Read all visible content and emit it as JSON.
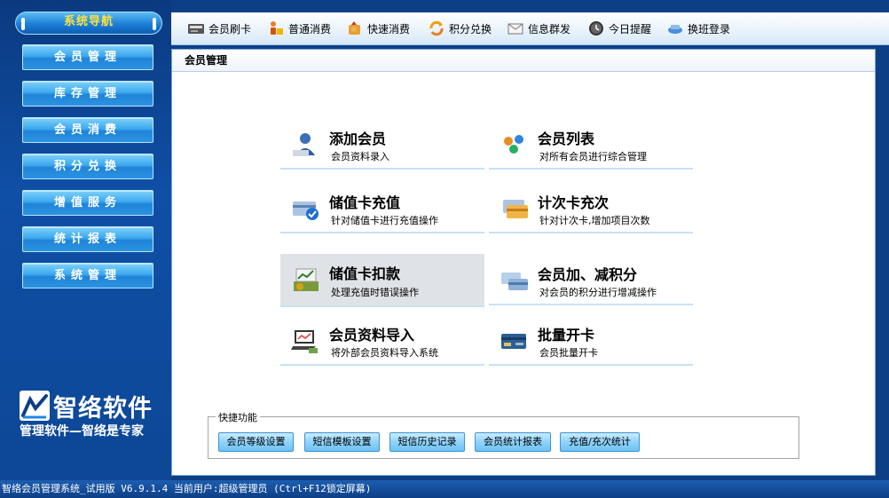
{
  "sidebar": {
    "header": "系统导航",
    "items": [
      {
        "label": "会员管理"
      },
      {
        "label": "库存管理"
      },
      {
        "label": "会员消费"
      },
      {
        "label": "积分兑换"
      },
      {
        "label": "增值服务"
      },
      {
        "label": "统计报表"
      },
      {
        "label": "系统管理"
      }
    ],
    "brand_name": "智络软件",
    "brand_slogan": "管理软件—智络是专家"
  },
  "toolbar": {
    "items": [
      {
        "label": "会员刷卡",
        "icon": "card-reader-icon"
      },
      {
        "label": "普通消费",
        "icon": "shopping-person-icon"
      },
      {
        "label": "快速消费",
        "icon": "fast-consume-icon"
      },
      {
        "label": "积分兑换",
        "icon": "exchange-icon"
      },
      {
        "label": "信息群发",
        "icon": "mail-icon"
      },
      {
        "label": "今日提醒",
        "icon": "clock-icon"
      },
      {
        "label": "换班登录",
        "icon": "shift-login-icon"
      }
    ]
  },
  "main": {
    "title": "会员管理",
    "cards": [
      {
        "title": "添加会员",
        "subtitle": "会员资料录入",
        "icon": "add-member-icon"
      },
      {
        "title": "会员列表",
        "subtitle": "对所有会员进行综合管理",
        "icon": "member-list-icon"
      },
      {
        "title": "储值卡充值",
        "subtitle": "针对储值卡进行充值操作",
        "icon": "stored-card-recharge-icon"
      },
      {
        "title": "计次卡充次",
        "subtitle": "针对计次卡,增加项目次数",
        "icon": "count-card-recharge-icon"
      },
      {
        "title": "储值卡扣款",
        "subtitle": "处理充值时错误操作",
        "icon": "money-deduct-icon"
      },
      {
        "title": "会员加、减积分",
        "subtitle": "对会员的积分进行增减操作",
        "icon": "points-adjust-icon"
      },
      {
        "title": "会员资料导入",
        "subtitle": "将外部会员资料导入系统",
        "icon": "import-data-icon"
      },
      {
        "title": "批量开卡",
        "subtitle": "会员批量开卡",
        "icon": "batch-card-icon"
      }
    ],
    "quick": {
      "legend": "快捷功能",
      "buttons": [
        {
          "label": "会员等级设置"
        },
        {
          "label": "短信模板设置"
        },
        {
          "label": "短信历史记录"
        },
        {
          "label": "会员统计报表"
        },
        {
          "label": "充值/充次统计"
        }
      ]
    }
  },
  "statusbar": {
    "text": "智络会员管理系统_试用版 V6.9.1.4 当前用户:超级管理员 (Ctrl+F12锁定屏幕)"
  },
  "colors": {
    "sidebar_bg": "#0d3f86",
    "menu_button": "#3ca8ee",
    "header_text": "#ffe23d",
    "selected_card": "#dfe3e8"
  }
}
